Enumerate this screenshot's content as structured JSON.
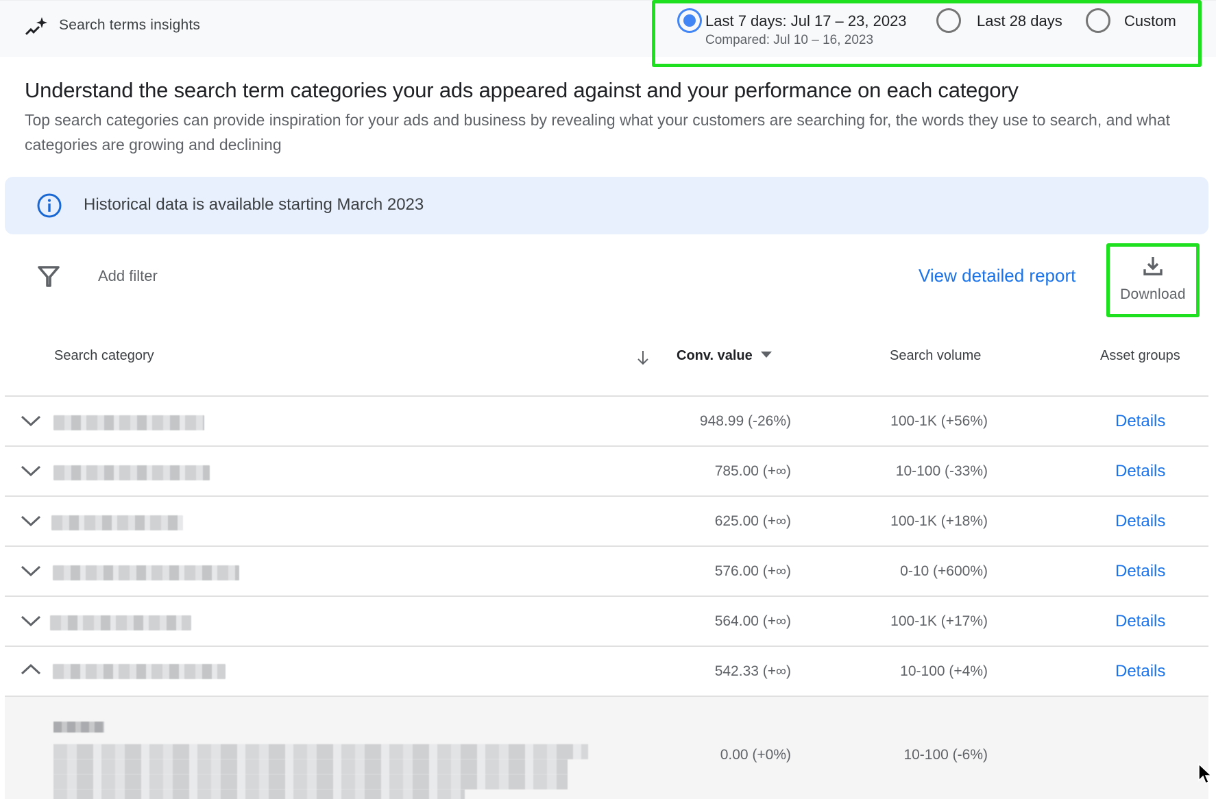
{
  "header": {
    "title": "Search terms insights",
    "icon": "insights-trend-sparkle-icon"
  },
  "date_range": {
    "options": [
      {
        "label": "Last 7 days: Jul 17 – 23, 2023",
        "sublabel": "Compared: Jul 10 – 16, 2023",
        "selected": true
      },
      {
        "label": "Last 28 days",
        "selected": false
      },
      {
        "label": "Custom",
        "selected": false
      }
    ],
    "highlight_color": "#1fe01f"
  },
  "intro": {
    "heading": "Understand the search term categories your ads appeared against and your performance on each category",
    "description": "Top search categories can provide inspiration for your ads and business by revealing what your customers are searching for, the words they use to search, and what categories are growing and declining"
  },
  "banner": {
    "icon": "info-icon",
    "text": "Historical data is available starting March 2023"
  },
  "toolbar": {
    "filter_icon": "filter-icon",
    "add_filter_label": "Add filter",
    "detailed_report_label": "View detailed report",
    "download_label": "Download",
    "download_icon": "download-icon"
  },
  "table": {
    "columns": [
      {
        "label": "Search category"
      },
      {
        "label": "Conv. value",
        "sorted": "descending"
      },
      {
        "label": "Search volume"
      },
      {
        "label": "Asset groups"
      }
    ],
    "rows": [
      {
        "category": "[blurred]",
        "conv_value": "948.99 (-26%)",
        "search_volume": "100-1K (+56%)",
        "asset_groups": "Details",
        "expanded": false
      },
      {
        "category": "[blurred]",
        "conv_value": "785.00 (+∞)",
        "search_volume": "10-100 (-33%)",
        "asset_groups": "Details",
        "expanded": false
      },
      {
        "category": "[blurred]",
        "conv_value": "625.00 (+∞)",
        "search_volume": "100-1K (+18%)",
        "asset_groups": "Details",
        "expanded": false
      },
      {
        "category": "[blurred]",
        "conv_value": "576.00 (+∞)",
        "search_volume": "0-10 (+600%)",
        "asset_groups": "Details",
        "expanded": false
      },
      {
        "category": "[blurred]",
        "conv_value": "564.00 (+∞)",
        "search_volume": "100-1K (+17%)",
        "asset_groups": "Details",
        "expanded": false
      },
      {
        "category": "[blurred]",
        "conv_value": "542.33 (+∞)",
        "search_volume": "10-100 (+4%)",
        "asset_groups": "Details",
        "expanded": true
      }
    ],
    "expanded_subrow": {
      "category": "[blurred]",
      "conv_value": "0.00 (+0%)",
      "search_volume": "10-100 (-6%)"
    }
  },
  "colors": {
    "accent": "#1a73e8",
    "radio_selected": "#4285f4",
    "banner_bg": "#e8f0fe"
  }
}
